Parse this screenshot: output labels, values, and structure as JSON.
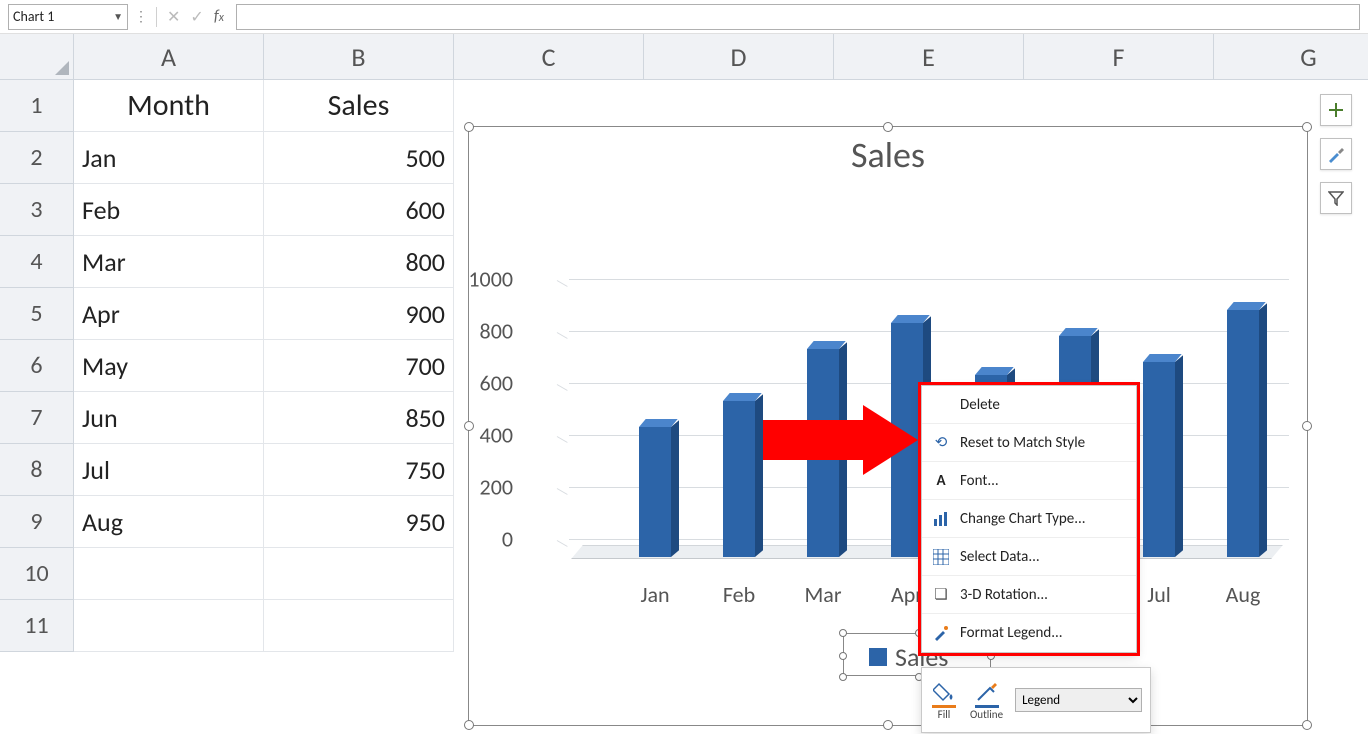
{
  "namebox": "Chart 1",
  "formula": "",
  "columns": [
    "A",
    "B",
    "C",
    "D",
    "E",
    "F",
    "G"
  ],
  "rows": [
    "1",
    "2",
    "3",
    "4",
    "5",
    "6",
    "7",
    "8",
    "9",
    "10",
    "11"
  ],
  "table_header": [
    "Month",
    "Sales"
  ],
  "table_rows": [
    [
      "Jan",
      "500"
    ],
    [
      "Feb",
      "600"
    ],
    [
      "Mar",
      "800"
    ],
    [
      "Apr",
      "900"
    ],
    [
      "May",
      "700"
    ],
    [
      "Jun",
      "850"
    ],
    [
      "Jul",
      "750"
    ],
    [
      "Aug",
      "950"
    ]
  ],
  "chart": {
    "title": "Sales",
    "yticks": [
      "0",
      "200",
      "400",
      "600",
      "800",
      "1000"
    ],
    "legend": "Sales"
  },
  "ctx": {
    "delete": "Delete",
    "reset": "Reset to Match Style",
    "font": "Font...",
    "type": "Change Chart Type...",
    "select_data": "Select Data...",
    "rotation": "3-D Rotation...",
    "format": "Format Legend..."
  },
  "mini": {
    "fill": "Fill",
    "outline": "Outline",
    "dropdown": "Legend"
  },
  "chart_data": {
    "type": "bar",
    "categories": [
      "Jan",
      "Feb",
      "Mar",
      "Apr",
      "May",
      "Jun",
      "Jul",
      "Aug"
    ],
    "values": [
      500,
      600,
      800,
      900,
      700,
      850,
      750,
      950
    ],
    "title": "Sales",
    "xlabel": "",
    "ylabel": "",
    "ylim": [
      0,
      1000
    ],
    "series": [
      {
        "name": "Sales",
        "values": [
          500,
          600,
          800,
          900,
          700,
          850,
          750,
          950
        ]
      }
    ]
  }
}
